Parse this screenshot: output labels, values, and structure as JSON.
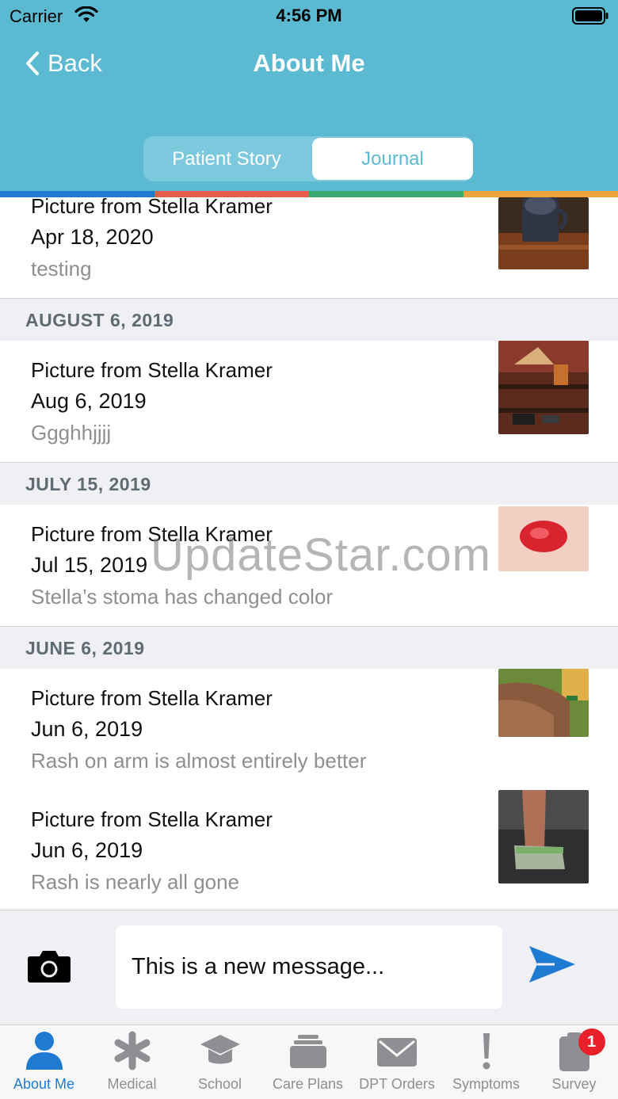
{
  "status_bar": {
    "carrier": "Carrier",
    "time": "4:56 PM"
  },
  "nav": {
    "back_label": "Back",
    "title": "About Me"
  },
  "segments": {
    "left": "Patient Story",
    "right": "Journal",
    "selected": "Journal"
  },
  "stripe_colors": [
    "#1f7bd1",
    "#e45e4b",
    "#3aa76d",
    "#f0a33a"
  ],
  "feed": {
    "entries": [
      {
        "title": "Picture from Stella Kramer",
        "date": "Apr 18, 2020",
        "note": "testing"
      },
      {
        "title": "Picture from Stella Kramer",
        "date": "Aug 6, 2019",
        "note": "Ggghhjjjj"
      },
      {
        "title": "Picture from Stella Kramer",
        "date": "Jul 15, 2019",
        "note": "Stella’s stoma has changed color"
      },
      {
        "title": "Picture from Stella Kramer",
        "date": "Jun 6, 2019",
        "note": "Rash on arm is almost entirely better"
      },
      {
        "title": "Picture from Stella Kramer",
        "date": "Jun 6, 2019",
        "note": "Rash is nearly all gone"
      }
    ],
    "sections": [
      "AUGUST 6, 2019",
      "JULY 15, 2019",
      "JUNE 6, 2019"
    ]
  },
  "watermark": "UpdateStar.com",
  "composer": {
    "message_value": "This is a new message..."
  },
  "tabbar": {
    "tabs": [
      {
        "label": "About Me",
        "icon": "person-icon",
        "active": true
      },
      {
        "label": "Medical",
        "icon": "asterisk-icon"
      },
      {
        "label": "School",
        "icon": "graduation-cap-icon"
      },
      {
        "label": "Care Plans",
        "icon": "stack-icon"
      },
      {
        "label": "DPT Orders",
        "icon": "envelope-icon"
      },
      {
        "label": "Symptoms",
        "icon": "exclamation-icon"
      },
      {
        "label": "Survey",
        "icon": "clipboard-icon",
        "badge": "1"
      }
    ]
  },
  "colors": {
    "header": "#5bb9d1",
    "accent": "#1f7bd1",
    "badge": "#e8202a"
  }
}
